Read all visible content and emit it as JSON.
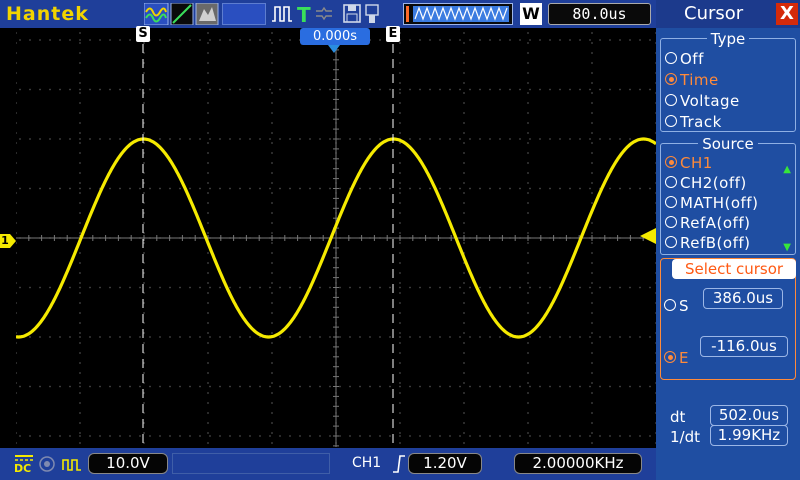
{
  "topbar": {
    "brand": "Hantek",
    "memory_mode_icon": "W",
    "timebase": "80.0us"
  },
  "screen": {
    "trigger_position": "0.000s",
    "cursor_s_label": "S",
    "cursor_e_label": "E",
    "ch1_marker": "1"
  },
  "bottombar": {
    "coupling": "DC",
    "ch1_scale": "10.0V",
    "trigger_source": "CH1",
    "trigger_level": "1.20V",
    "frequency": "2.00000KHz"
  },
  "panel": {
    "title": "Cursor",
    "close": "X",
    "type_label": "Type",
    "type_options": [
      "Off",
      "Time",
      "Voltage",
      "Track"
    ],
    "type_selected": "Time",
    "source_label": "Source",
    "source_options": [
      "CH1",
      "CH2(off)",
      "MATH(off)",
      "RefA(off)",
      "RefB(off)"
    ],
    "source_selected": "CH1",
    "select_cursor_label": "Select cursor",
    "s_label": "S",
    "s_value": "386.0us",
    "e_label": "E",
    "e_value": "-116.0us",
    "dt_label": "dt",
    "dt_value": "502.0us",
    "inv_dt_label": "1/dt",
    "inv_dt_value": "1.99KHz"
  },
  "colors": {
    "trace": "#f5ea00",
    "bar": "#1f3f9a",
    "panel": "#1f4ea2",
    "accent": "#ff8a3a"
  },
  "waveform": {
    "frequency_hz": 2000,
    "amplitude_divisions": 2
  }
}
